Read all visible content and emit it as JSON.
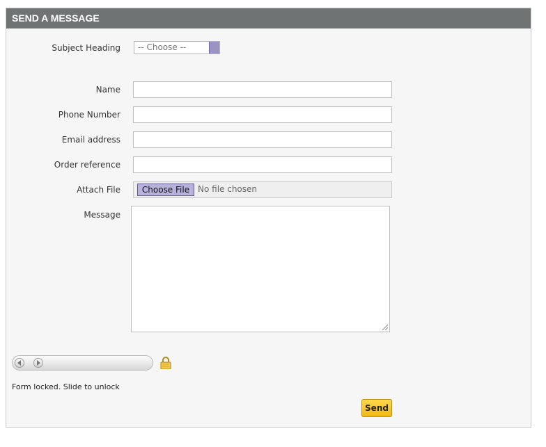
{
  "header": {
    "title": "SEND A MESSAGE"
  },
  "form": {
    "subject_label": "Subject Heading",
    "subject_value": "-- Choose --",
    "name_label": "Name",
    "phone_label": "Phone Number",
    "email_label": "Email address",
    "order_label": "Order reference",
    "attach_label": "Attach File",
    "file_button": "Choose File",
    "file_status": "No file chosen",
    "message_label": "Message"
  },
  "slider": {
    "status_text": "Form locked. Slide to unlock"
  },
  "actions": {
    "send_label": "Send"
  },
  "colors": {
    "header_bg": "#6f7373",
    "send_button": "#f5c22a",
    "file_button": "#b7b2dd"
  }
}
